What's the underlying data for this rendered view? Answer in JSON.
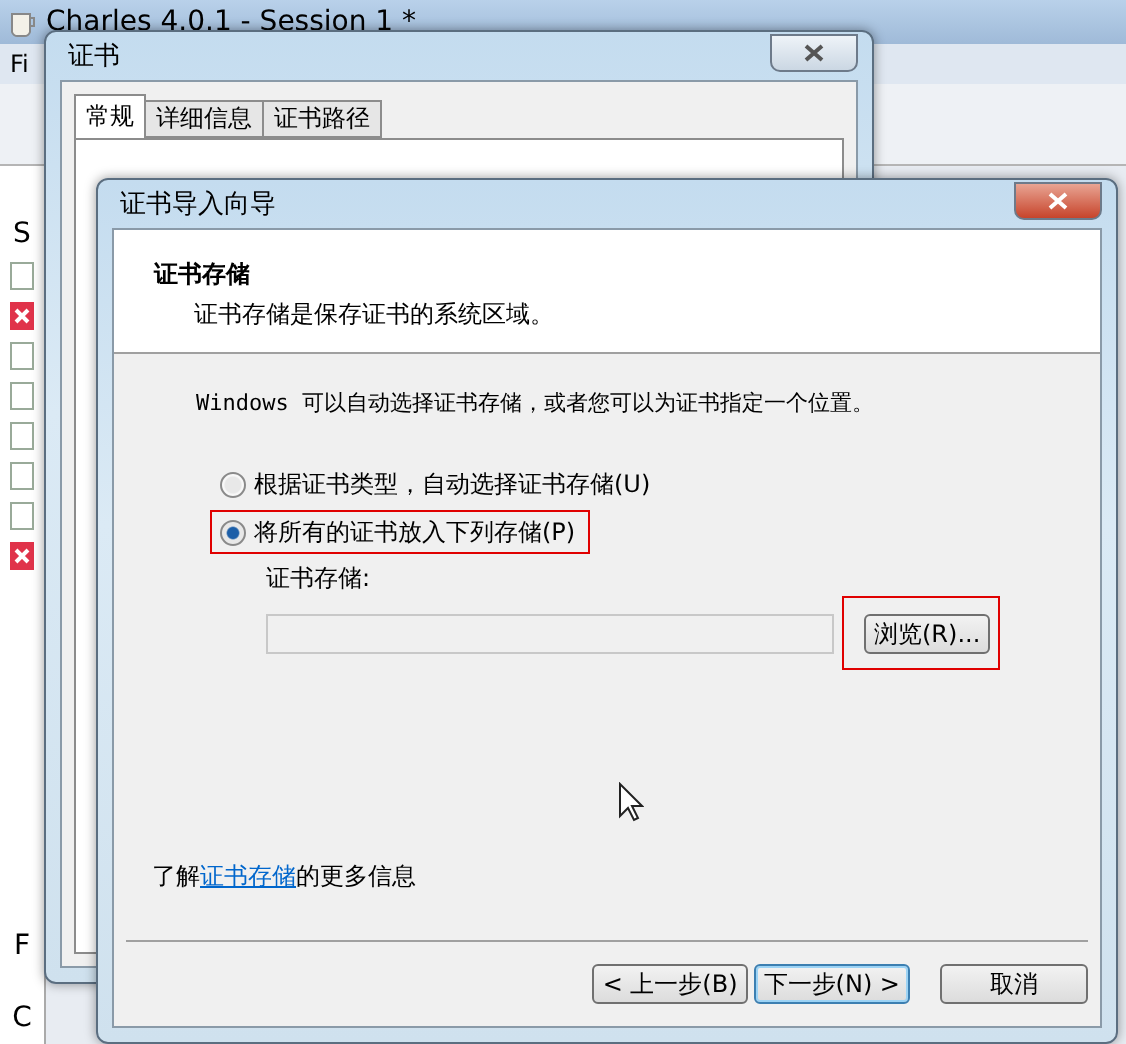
{
  "background_window": {
    "title": "Charles 4.0.1 - Session 1 *",
    "menu_fragment": "Fi",
    "sidebar_fragments": [
      "S",
      "F",
      "C"
    ]
  },
  "certificate_window": {
    "title": "证书",
    "tabs": [
      {
        "label": "常规",
        "selected": true
      },
      {
        "label": "详细信息",
        "selected": false
      },
      {
        "label": "证书路径",
        "selected": false
      }
    ]
  },
  "wizard": {
    "title": "证书导入向导",
    "header": {
      "title": "证书存储",
      "subtitle": "证书存储是保存证书的系统区域。"
    },
    "intro": "Windows 可以自动选择证书存储，或者您可以为证书指定一个位置。",
    "options": [
      {
        "label": "根据证书类型，自动选择证书存储(U)",
        "selected": false,
        "highlighted": false
      },
      {
        "label": "将所有的证书放入下列存储(P)",
        "selected": true,
        "highlighted": true
      }
    ],
    "store_label": "证书存储:",
    "browse_button": {
      "label": "浏览(R)...",
      "highlighted": true
    },
    "more_info": {
      "before": "了解",
      "link": "证书存储",
      "after": "的更多信息"
    },
    "buttons": [
      {
        "label": "< 上一步(B)",
        "focused": false
      },
      {
        "label": "下一步(N) >",
        "focused": true
      },
      {
        "label": "取消",
        "focused": false
      }
    ]
  }
}
